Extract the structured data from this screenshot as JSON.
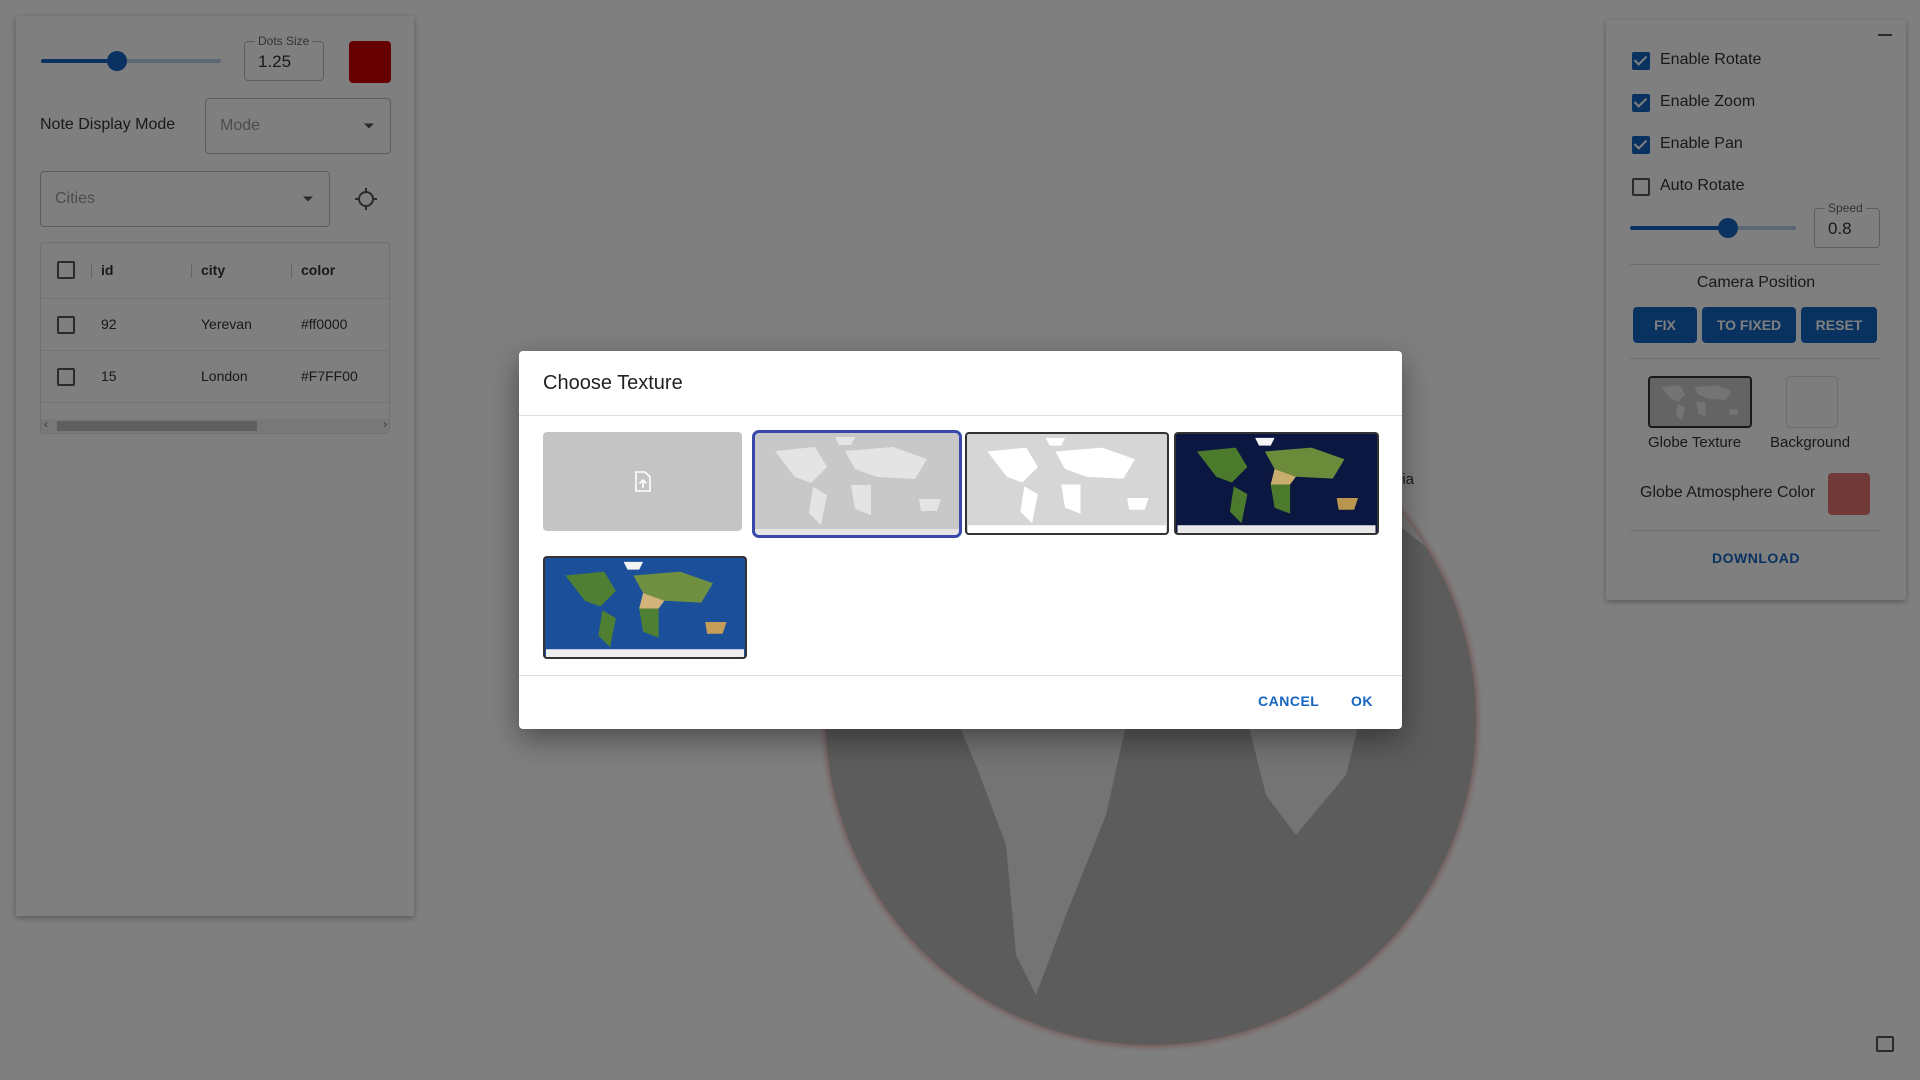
{
  "left_panel": {
    "dots_size": {
      "legend": "Dots Size",
      "value": "1.25",
      "slider_fraction": 0.42
    },
    "dot_color": "#cc0000",
    "note_display_mode": {
      "label": "Note Display Mode",
      "placeholder": "Mode"
    },
    "cities_select": {
      "placeholder": "Cities"
    },
    "table": {
      "columns": [
        "id",
        "city",
        "color"
      ],
      "rows": [
        {
          "id": "92",
          "city": "Yerevan",
          "color": "#ff0000"
        },
        {
          "id": "15",
          "city": "London",
          "color": "#F7FF00"
        }
      ]
    }
  },
  "tooltip_chip": "nia",
  "right_panel": {
    "checkboxes": [
      {
        "label": "Enable Rotate",
        "checked": true
      },
      {
        "label": "Enable Zoom",
        "checked": true
      },
      {
        "label": "Enable Pan",
        "checked": true
      },
      {
        "label": "Auto Rotate",
        "checked": false
      }
    ],
    "speed": {
      "legend": "Speed",
      "value": "0.8",
      "slider_fraction": 0.58
    },
    "camera_position_label": "Camera Position",
    "buttons": {
      "fix": "FIX",
      "to_fixed": "TO FIXED",
      "reset": "RESET"
    },
    "globe_texture_label": "Globe Texture",
    "background_label": "Background",
    "atmosphere_label": "Globe Atmosphere Color",
    "atmosphere_color": "#e57373",
    "download": "DOWNLOAD"
  },
  "dialog": {
    "title": "Choose Texture",
    "cancel": "CANCEL",
    "ok": "OK",
    "textures": [
      "upload-texture",
      "gray-map-texture",
      "white-gray-map-texture",
      "dark-earth-texture",
      "blue-earth-texture"
    ],
    "selected": "gray-map-texture"
  },
  "colors": {
    "accent": "#1565c0",
    "selection": "#3949ab"
  }
}
